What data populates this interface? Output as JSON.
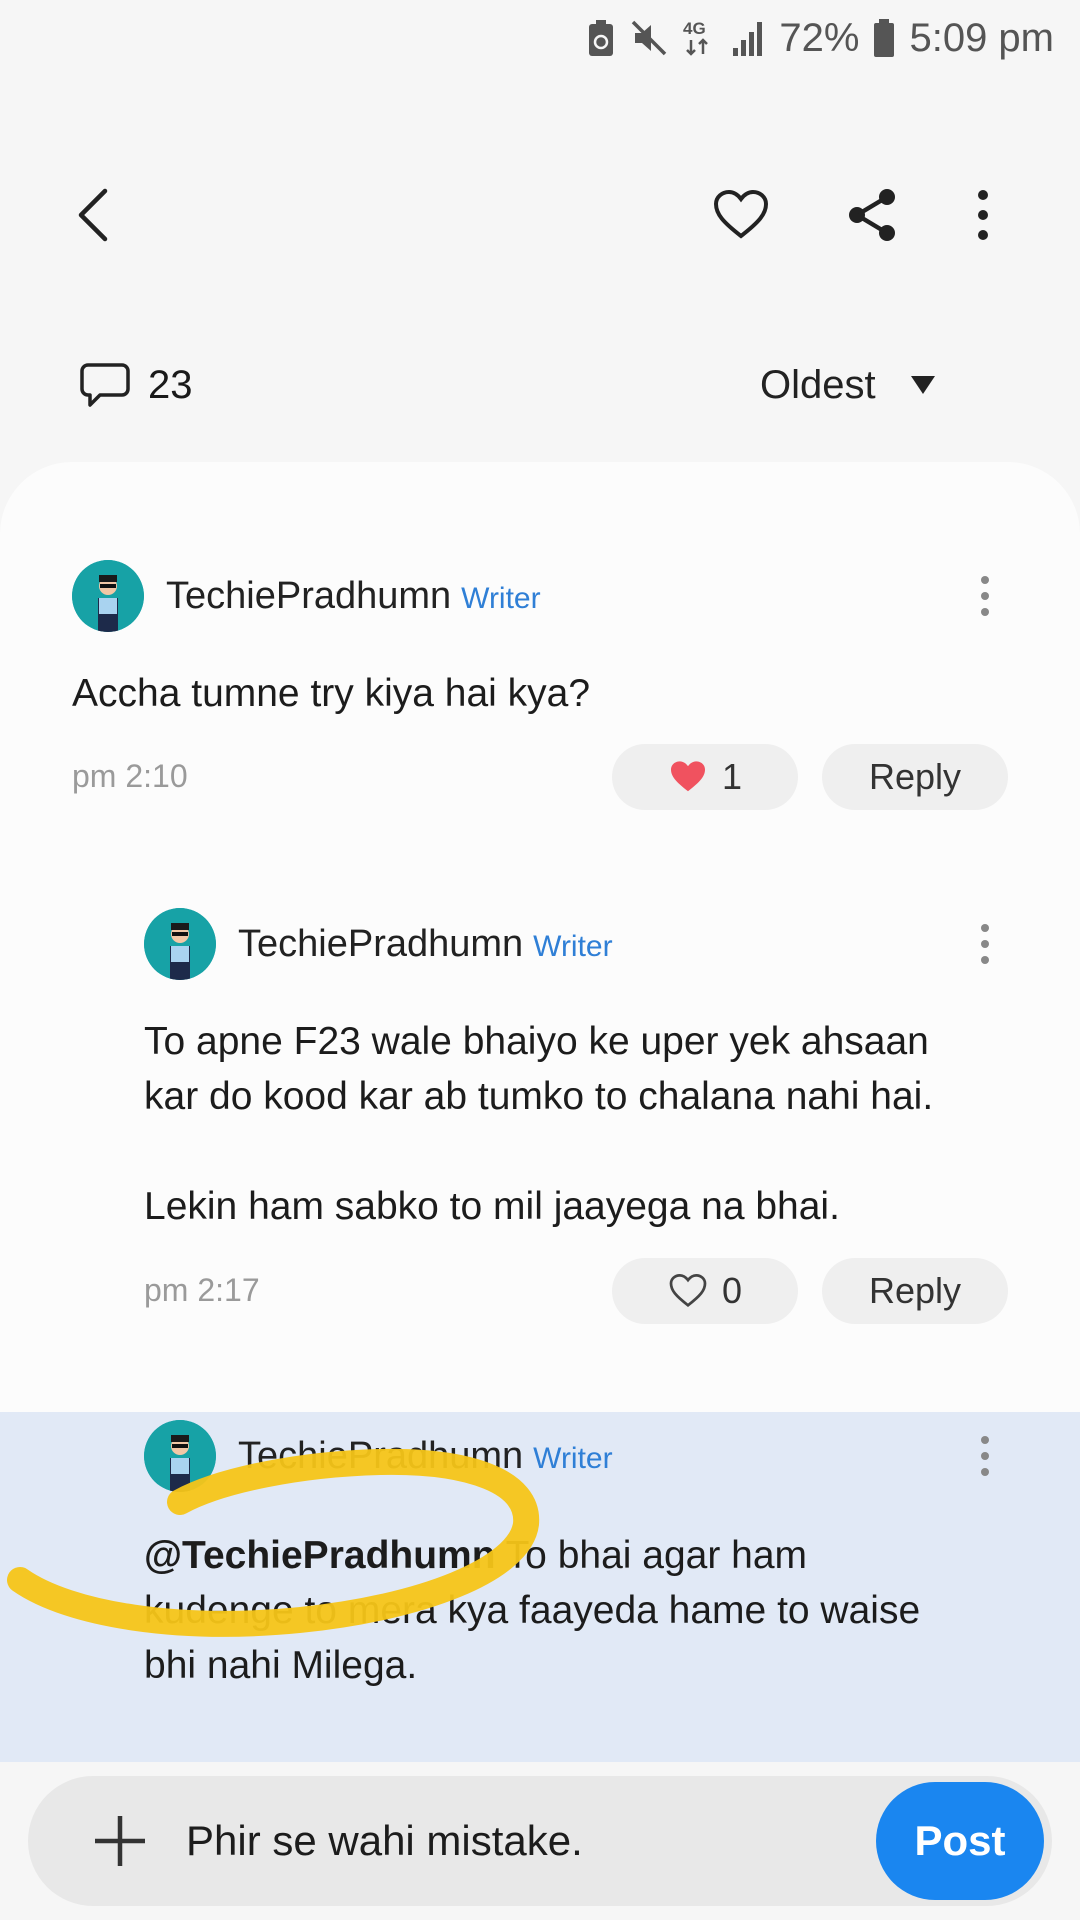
{
  "status_bar": {
    "network": "4G",
    "battery": "72%",
    "time": "5:09 pm"
  },
  "comment_header": {
    "count": "23",
    "sort_label": "Oldest"
  },
  "comments": [
    {
      "author": "TechiePradhumn",
      "tag": "Writer",
      "body": "Accha tumne try kiya hai kya?",
      "time": "pm 2:10",
      "likes": "1",
      "liked": true,
      "reply_label": "Reply"
    },
    {
      "author": "TechiePradhumn",
      "tag": "Writer",
      "body_line1": "To apne F23 wale bhaiyo ke uper yek ahsaan",
      "body_line2": "kar do kood kar ab tumko to chalana nahi hai.",
      "body_line3": "Lekin ham sabko to mil jaayega na bhai.",
      "time": "pm 2:17",
      "likes": "0",
      "liked": false,
      "reply_label": "Reply"
    },
    {
      "author": "TechiePradhumn",
      "tag": "Writer",
      "mention": "@TechiePradhumn",
      "body_line1_rest": " To bhai agar ham",
      "body_line2": "kudenge to mera kya faayeda hame to waise",
      "body_line3": "bhi nahi Milega."
    }
  ],
  "input": {
    "value": "Phir se wahi mistake.",
    "post_label": "Post"
  },
  "colors": {
    "accent": "#1a86f0",
    "writer_tag": "#2f7fd6",
    "highlight_row": "#e1e9f6",
    "heart": "#f0525f",
    "scribble": "#f5c518"
  }
}
